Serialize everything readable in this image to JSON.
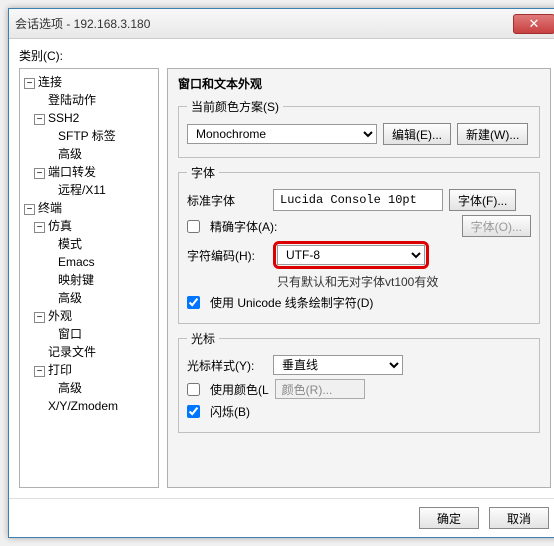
{
  "window": {
    "title": "会话选项 - 192.168.3.180"
  },
  "left": {
    "category_label": "类别(C):",
    "tree": {
      "conn": "连接",
      "login": "登陆动作",
      "ssh2": "SSH2",
      "sftp": "SFTP 标签",
      "adv1": "高级",
      "portfwd": "端口转发",
      "x11": "远程/X11",
      "term": "终端",
      "emu": "仿真",
      "mode": "模式",
      "emacs": "Emacs",
      "keymap": "映射键",
      "adv2": "高级",
      "appear": "外观",
      "window2": "窗口",
      "logfile": "记录文件",
      "print": "打印",
      "adv3": "高级",
      "xyz": "X/Y/Zmodem"
    }
  },
  "right": {
    "header": "窗口和文本外观",
    "scheme_group": "当前颜色方案(S)",
    "scheme_value": "Monochrome",
    "edit_btn": "编辑(E)...",
    "new_btn": "新建(W)...",
    "font_group": "字体",
    "std_font_label": "标准字体",
    "std_font_value": "Lucida Console 10pt",
    "font_btn": "字体(F)...",
    "exact_font": "精确字体(A):",
    "font_btn2": "字体(O)...",
    "enc_label": "字符编码(H):",
    "enc_value": "UTF-8",
    "enc_note": "只有默认和无对字体vt100有效",
    "use_unicode": "使用 Unicode 线条绘制字符(D)",
    "cursor_group": "光标",
    "cursor_style": "光标样式(Y):",
    "cursor_value": "垂直线",
    "use_color": "使用颜色(L",
    "color_pick": "颜色(R)...",
    "blink": "闪烁(B)"
  },
  "footer": {
    "ok": "确定",
    "cancel": "取消"
  }
}
